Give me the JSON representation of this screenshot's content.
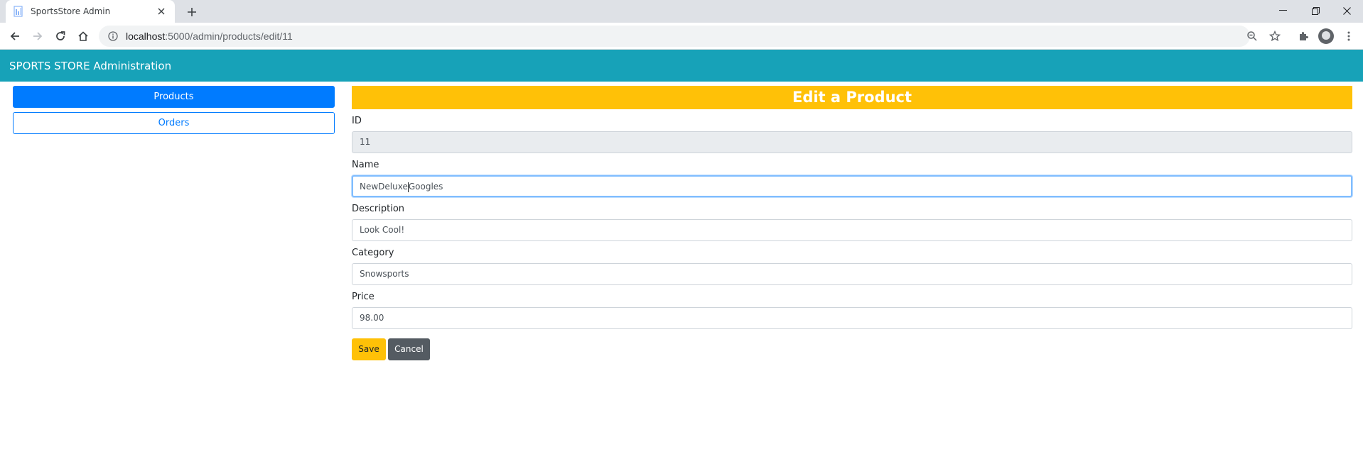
{
  "browser": {
    "tab_title": "SportsStore Admin",
    "url_host": "localhost",
    "url_path": ":5000/admin/products/edit/11",
    "icons": {
      "favicon": "document-icon",
      "close": "close-icon",
      "new_tab": "plus-icon",
      "back": "arrow-left-icon",
      "forward": "arrow-right-icon",
      "reload": "reload-icon",
      "home": "home-icon",
      "info": "info-icon",
      "zoom": "zoom-icon",
      "bookmark": "star-icon",
      "extensions": "puzzle-icon",
      "profile": "avatar",
      "menu": "kebab-menu-icon"
    }
  },
  "navbar": {
    "brand": "SPORTS STORE Administration",
    "color": "#17a2b8"
  },
  "sidebar": {
    "items": [
      {
        "label": "Products",
        "active": true
      },
      {
        "label": "Orders",
        "active": false
      }
    ]
  },
  "form": {
    "heading": "Edit a Product",
    "heading_color": "#ffc107",
    "fields": [
      {
        "label": "ID",
        "value": "11",
        "readonly": true
      },
      {
        "label": "Name",
        "value_before_caret": "NewDeluxe",
        "value_after_caret": "Googles",
        "focused": true
      },
      {
        "label": "Description",
        "value": "Look Cool!"
      },
      {
        "label": "Category",
        "value": "Snowsports"
      },
      {
        "label": "Price",
        "value": "98.00"
      }
    ],
    "save_label": "Save",
    "cancel_label": "Cancel"
  }
}
